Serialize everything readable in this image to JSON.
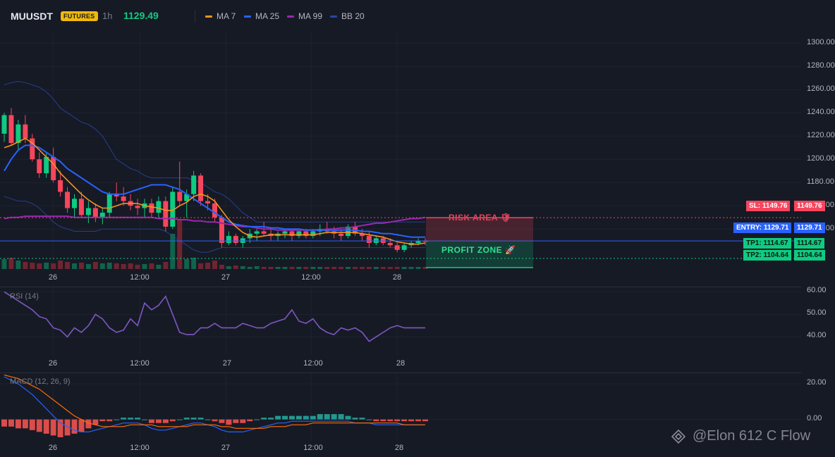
{
  "header": {
    "symbol": "MUUSDT",
    "badge": "FUTURES",
    "timeframe": "1h",
    "last_price": "1129.49",
    "indicators": [
      {
        "label": "MA 7",
        "color": "#f7931a"
      },
      {
        "label": "MA 25",
        "color": "#2962ff"
      },
      {
        "label": "MA 99",
        "color": "#9c27b0"
      },
      {
        "label": "BB 20",
        "color": "#2846a0"
      }
    ]
  },
  "colors": {
    "bg": "#161a25",
    "up": "#0ecb81",
    "down": "#f6465d",
    "grid": "#1f2330",
    "entry": "#2962ff",
    "sl": "#f6465d",
    "tp": "#0ecb81"
  },
  "price_axis": {
    "ticks": [
      "1300.00",
      "1280.00",
      "1260.00",
      "1240.00",
      "1220.00",
      "1200.00",
      "1180.00",
      "1160.00",
      "1140.00"
    ],
    "min": 1108,
    "max": 1308
  },
  "time_axis": {
    "labels": [
      "26",
      "12:00",
      "27",
      "12:00",
      "28"
    ]
  },
  "trade": {
    "sl_label": "SL: 1149.76",
    "sl_value": "1149.76",
    "sl": 1149.76,
    "entry_label": "ENTRY: 1129.71",
    "entry_value": "1129.71",
    "entry": 1129.71,
    "tp1_label": "TP1: 1114.67",
    "tp1_value": "1114.67",
    "tp1": 1114.67,
    "tp2_label": "TP2: 1104.64",
    "tp2_value": "1104.64",
    "tp2": 1104.64,
    "risk_label": "RISK AREA 🛡",
    "profit_label": "PROFIT ZONE 🚀"
  },
  "chart_data": {
    "type": "candlestick",
    "candles": [
      [
        1222,
        1240,
        1215,
        1238
      ],
      [
        1238,
        1244,
        1212,
        1214
      ],
      [
        1214,
        1234,
        1208,
        1230
      ],
      [
        1230,
        1238,
        1214,
        1218
      ],
      [
        1218,
        1222,
        1198,
        1200
      ],
      [
        1200,
        1206,
        1184,
        1188
      ],
      [
        1188,
        1206,
        1184,
        1202
      ],
      [
        1202,
        1210,
        1180,
        1182
      ],
      [
        1182,
        1190,
        1168,
        1172
      ],
      [
        1172,
        1176,
        1154,
        1158
      ],
      [
        1158,
        1170,
        1150,
        1166
      ],
      [
        1166,
        1172,
        1150,
        1152
      ],
      [
        1152,
        1164,
        1145,
        1158
      ],
      [
        1158,
        1162,
        1146,
        1150
      ],
      [
        1150,
        1158,
        1144,
        1154
      ],
      [
        1154,
        1172,
        1150,
        1170
      ],
      [
        1170,
        1180,
        1164,
        1168
      ],
      [
        1168,
        1176,
        1160,
        1164
      ],
      [
        1164,
        1170,
        1156,
        1160
      ],
      [
        1160,
        1166,
        1152,
        1158
      ],
      [
        1158,
        1166,
        1150,
        1162
      ],
      [
        1162,
        1166,
        1150,
        1154
      ],
      [
        1154,
        1168,
        1150,
        1164
      ],
      [
        1164,
        1168,
        1138,
        1142
      ],
      [
        1142,
        1176,
        1140,
        1172
      ],
      [
        1172,
        1198,
        1160,
        1164
      ],
      [
        1164,
        1174,
        1150,
        1170
      ],
      [
        1170,
        1190,
        1164,
        1186
      ],
      [
        1186,
        1188,
        1160,
        1164
      ],
      [
        1164,
        1170,
        1156,
        1162
      ],
      [
        1162,
        1166,
        1146,
        1150
      ],
      [
        1150,
        1152,
        1124,
        1128
      ],
      [
        1128,
        1138,
        1126,
        1134
      ],
      [
        1134,
        1136,
        1126,
        1128
      ],
      [
        1128,
        1134,
        1124,
        1132
      ],
      [
        1132,
        1140,
        1128,
        1136
      ],
      [
        1136,
        1140,
        1130,
        1138
      ],
      [
        1138,
        1146,
        1134,
        1136
      ],
      [
        1136,
        1140,
        1130,
        1134
      ],
      [
        1134,
        1138,
        1130,
        1136
      ],
      [
        1136,
        1140,
        1132,
        1138
      ],
      [
        1138,
        1140,
        1130,
        1134
      ],
      [
        1134,
        1140,
        1132,
        1138
      ],
      [
        1138,
        1140,
        1132,
        1134
      ],
      [
        1134,
        1140,
        1132,
        1138
      ],
      [
        1138,
        1144,
        1134,
        1140
      ],
      [
        1140,
        1146,
        1136,
        1138
      ],
      [
        1138,
        1142,
        1132,
        1136
      ],
      [
        1136,
        1140,
        1130,
        1134
      ],
      [
        1134,
        1144,
        1132,
        1142
      ],
      [
        1142,
        1146,
        1134,
        1136
      ],
      [
        1136,
        1140,
        1130,
        1134
      ],
      [
        1134,
        1138,
        1124,
        1128
      ],
      [
        1128,
        1134,
        1126,
        1132
      ],
      [
        1132,
        1134,
        1126,
        1128
      ],
      [
        1128,
        1132,
        1124,
        1126
      ],
      [
        1126,
        1128,
        1120,
        1122
      ],
      [
        1122,
        1128,
        1120,
        1126
      ],
      [
        1126,
        1130,
        1124,
        1128
      ],
      [
        1128,
        1132,
        1126,
        1130
      ],
      [
        1130,
        1132,
        1126,
        1129
      ]
    ],
    "ma7": [
      1210,
      1212,
      1215,
      1218,
      1214,
      1208,
      1202,
      1196,
      1188,
      1182,
      1176,
      1170,
      1165,
      1161,
      1158,
      1158,
      1160,
      1162,
      1162,
      1162,
      1160,
      1159,
      1158,
      1156,
      1156,
      1160,
      1163,
      1168,
      1170,
      1168,
      1164,
      1156,
      1148,
      1142,
      1137,
      1134,
      1133,
      1134,
      1135,
      1135,
      1135,
      1135,
      1135,
      1135,
      1135,
      1136,
      1137,
      1137,
      1137,
      1137,
      1137,
      1136,
      1135,
      1134,
      1133,
      1131,
      1129,
      1128,
      1127,
      1127,
      1128
    ],
    "ma25": [
      1190,
      1200,
      1208,
      1212,
      1212,
      1210,
      1206,
      1202,
      1198,
      1192,
      1188,
      1184,
      1180,
      1176,
      1172,
      1170,
      1170,
      1170,
      1172,
      1174,
      1176,
      1178,
      1178,
      1178,
      1176,
      1174,
      1170,
      1166,
      1162,
      1158,
      1154,
      1150,
      1146,
      1144,
      1143,
      1142,
      1142,
      1142,
      1141,
      1141,
      1140,
      1140,
      1140,
      1139,
      1139,
      1139,
      1139,
      1139,
      1139,
      1139,
      1139,
      1138,
      1138,
      1137,
      1136,
      1136,
      1135,
      1134,
      1133,
      1133,
      1133
    ],
    "ma99": [
      1149,
      1150,
      1150,
      1151,
      1151,
      1151,
      1151,
      1151,
      1151,
      1151,
      1150,
      1150,
      1150,
      1150,
      1150,
      1150,
      1150,
      1150,
      1150,
      1150,
      1150,
      1150,
      1149,
      1149,
      1149,
      1148,
      1148,
      1147,
      1147,
      1146,
      1146,
      1145,
      1144,
      1143,
      1142,
      1142,
      1141,
      1140,
      1140,
      1139,
      1139,
      1139,
      1139,
      1139,
      1139,
      1139,
      1140,
      1140,
      1141,
      1141,
      1142,
      1143,
      1144,
      1145,
      1145,
      1146,
      1147,
      1148,
      1149,
      1149,
      1150
    ],
    "bb_upper": [
      1264,
      1266,
      1267,
      1266,
      1264,
      1262,
      1258,
      1252,
      1244,
      1240,
      1236,
      1232,
      1230,
      1226,
      1220,
      1210,
      1200,
      1196,
      1192,
      1190,
      1186,
      1184,
      1184,
      1184,
      1184,
      1184,
      1184,
      1182,
      1180,
      1176,
      1172,
      1170,
      1166,
      1160,
      1154,
      1150,
      1146,
      1146,
      1146,
      1146,
      1146,
      1146,
      1146,
      1146,
      1146,
      1146,
      1146,
      1146,
      1146,
      1146,
      1146,
      1146,
      1146,
      1146,
      1146,
      1146,
      1146,
      1146,
      1146,
      1146,
      1146
    ],
    "bb_lower": [
      1168,
      1166,
      1164,
      1164,
      1162,
      1158,
      1152,
      1146,
      1142,
      1140,
      1138,
      1138,
      1138,
      1138,
      1140,
      1140,
      1140,
      1140,
      1140,
      1140,
      1140,
      1140,
      1140,
      1138,
      1134,
      1130,
      1126,
      1122,
      1120,
      1120,
      1122,
      1124,
      1124,
      1124,
      1124,
      1124,
      1124,
      1124,
      1124,
      1124,
      1124,
      1124,
      1124,
      1124,
      1124,
      1124,
      1124,
      1124,
      1124,
      1124,
      1124,
      1124,
      1124,
      1124,
      1124,
      1124,
      1124,
      1124,
      1124,
      1124,
      1124
    ],
    "volume": [
      14,
      16,
      12,
      10,
      9,
      8,
      9,
      8,
      12,
      10,
      8,
      9,
      7,
      10,
      8,
      9,
      8,
      7,
      8,
      6,
      7,
      8,
      6,
      10,
      50,
      70,
      14,
      16,
      8,
      9,
      12,
      6,
      4,
      5,
      4,
      3,
      4,
      3,
      3,
      3,
      3,
      3,
      3,
      3,
      3,
      3,
      3,
      3,
      3,
      3,
      3,
      3,
      3,
      3,
      3,
      3,
      3,
      3,
      3,
      3,
      3
    ],
    "rsi": {
      "title": "RSI (14)",
      "ticks": [
        "60.00",
        "50.00",
        "40.00"
      ],
      "min": 32,
      "max": 62,
      "values": [
        60,
        58,
        56,
        54,
        52,
        49,
        48,
        44,
        43,
        40,
        44,
        42,
        45,
        50,
        48,
        44,
        42,
        43,
        48,
        45,
        55,
        52,
        54,
        58,
        50,
        42,
        41,
        41,
        44,
        44,
        46,
        44,
        44,
        44,
        46,
        45,
        44,
        44,
        46,
        47,
        48,
        52,
        47,
        46,
        48,
        44,
        42,
        41,
        44,
        43,
        44,
        42,
        38,
        40,
        42,
        44,
        45,
        44,
        44,
        44,
        44
      ]
    },
    "macd": {
      "title": "MACD (12, 26, 9)",
      "ticks": [
        "20.00",
        "0.00"
      ],
      "min": -12,
      "max": 26,
      "macd": [
        24,
        22,
        20,
        17,
        14,
        10,
        6,
        2,
        -2,
        -4,
        -6,
        -7,
        -7,
        -6,
        -5,
        -4,
        -3,
        -2,
        -2,
        -2,
        -3,
        -5,
        -6,
        -6,
        -5,
        -4,
        -3,
        -2,
        -2,
        -3,
        -4,
        -6,
        -7,
        -7,
        -7,
        -6,
        -5,
        -4,
        -3,
        -2,
        -2,
        -1,
        -1,
        -1,
        -1,
        -1,
        -1,
        -1,
        -1,
        -1,
        -2,
        -2,
        -2,
        -3,
        -3,
        -3,
        -3,
        -3,
        -3,
        -3,
        -3
      ],
      "signal": [
        25,
        24,
        23,
        21,
        19,
        17,
        14,
        11,
        8,
        5,
        2,
        0,
        -2,
        -3,
        -4,
        -4,
        -4,
        -4,
        -3,
        -3,
        -3,
        -3,
        -4,
        -4,
        -4,
        -4,
        -4,
        -3,
        -3,
        -3,
        -3,
        -4,
        -4,
        -5,
        -5,
        -5,
        -5,
        -5,
        -4,
        -4,
        -4,
        -3,
        -3,
        -3,
        -2,
        -2,
        -2,
        -2,
        -2,
        -2,
        -2,
        -2,
        -2,
        -2,
        -2,
        -2,
        -2,
        -3,
        -3,
        -3,
        -3
      ],
      "hist": [
        -4,
        -4,
        -5,
        -5,
        -6,
        -7,
        -8,
        -9,
        -10,
        -9,
        -8,
        -7,
        -5,
        -3,
        -1,
        -1,
        0,
        1,
        1,
        1,
        0,
        -2,
        -2,
        -2,
        -1,
        0,
        1,
        1,
        1,
        0,
        -1,
        -2,
        -3,
        -2,
        -2,
        -1,
        0,
        1,
        1,
        2,
        2,
        2,
        2,
        2,
        2,
        3,
        3,
        3,
        3,
        2,
        1,
        1,
        0,
        -1,
        -1,
        -1,
        -1,
        -1,
        -1,
        -1,
        -1
      ]
    }
  },
  "watermark": "@Elon 612 C Flow"
}
